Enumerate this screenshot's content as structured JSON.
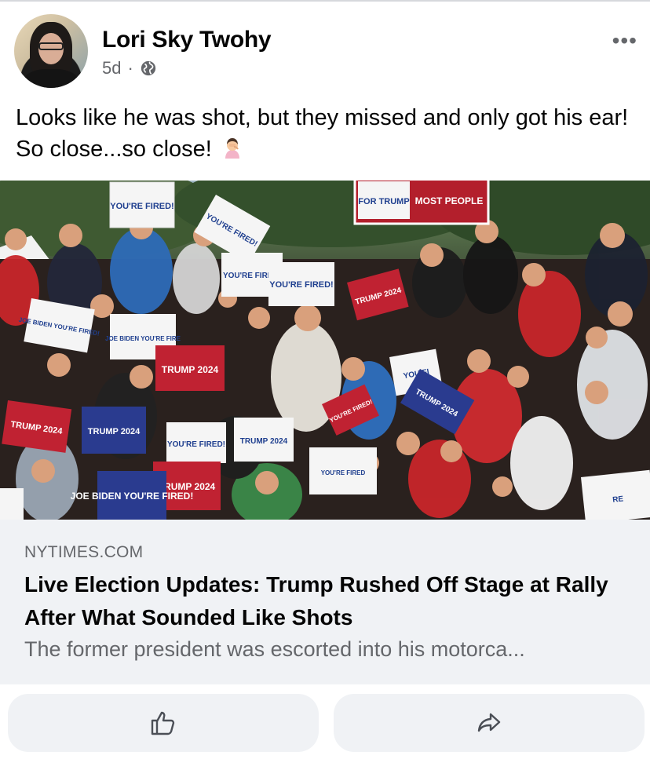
{
  "post": {
    "author": "Lori Sky Twohy",
    "time": "5d",
    "separator": "·",
    "audience_icon": "globe-icon",
    "more_label": "•••",
    "text": "Looks like he was shot, but they missed and only got his ear! So close...so close!",
    "text_emoji": "person-facepalming-emoji"
  },
  "photo": {
    "signs": [
      "YOU'RE FIRED!",
      "YOU'RE FIRED!",
      "FOR TRUMP",
      "MOST PEOPLE",
      "YOU'RE FIRED!",
      "YOU'RE FIRED!",
      "TRUMP 2024",
      "JOE BIDEN YOU'RE FIRED!",
      "JOE BIDEN YOU'RE FIRE",
      "TRUMP 2024",
      "YOU FI",
      "TRUMP 2024",
      "TRUMP 2024",
      "TRUMP 2024",
      "YOU'RE FIRED!",
      "YOU'RE FIRED!",
      "TRUMP 2024",
      "TRUMP 2024",
      "JOE BIDEN YOU'RE FIRED!",
      "YOU'RE FIRED",
      "RE"
    ]
  },
  "link": {
    "domain": "NYTIMES.COM",
    "headline": "Live Election Updates: Trump Rushed Off Stage at Rally After What Sounded Like Shots",
    "description": "The former president was escorted into his motorca..."
  },
  "actions": {
    "like_icon": "thumbs-up-icon",
    "share_icon": "share-arrow-icon"
  }
}
